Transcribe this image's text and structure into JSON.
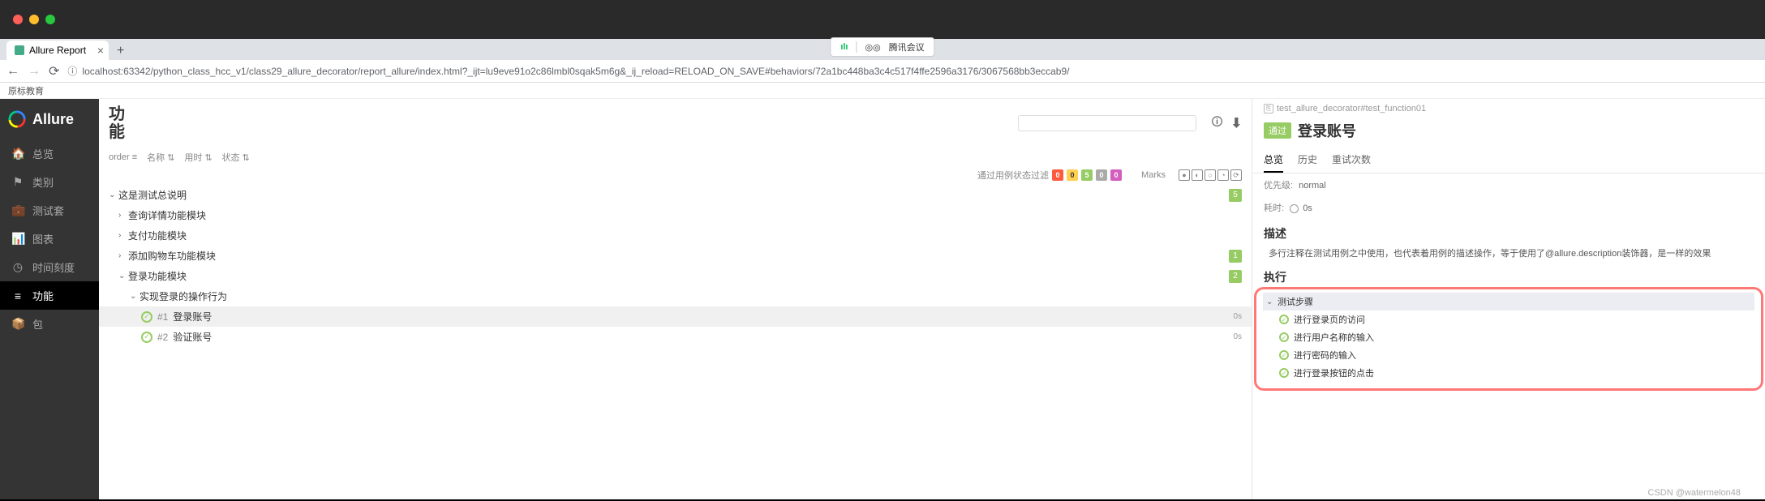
{
  "browser": {
    "tab_title": "Allure Report",
    "url": "localhost:63342/python_class_hcc_v1/class29_allure_decorator/report_allure/index.html?_ijt=lu9eve91o2c86lmbl0sqak5m6g&_ij_reload=RELOAD_ON_SAVE#behaviors/72a1bc448ba3c4c517f4ffe2596a3176/3067568bb3eccab9/",
    "bookmark": "原标教育",
    "meeting_label": "腾讯会议"
  },
  "sidebar": {
    "brand": "Allure",
    "items": [
      {
        "icon": "🏠",
        "label": "总览"
      },
      {
        "icon": "⚑",
        "label": "类别"
      },
      {
        "icon": "💼",
        "label": "测试套"
      },
      {
        "icon": "📊",
        "label": "图表"
      },
      {
        "icon": "◷",
        "label": "时间刻度"
      },
      {
        "icon": "≡",
        "label": "功能"
      },
      {
        "icon": "📦",
        "label": "包"
      }
    ]
  },
  "center": {
    "title": "功能",
    "sort": {
      "order_label": "order",
      "cols": [
        "名称",
        "用时",
        "状态"
      ]
    },
    "filter_label": "通过用例状态过滤",
    "status_counts": [
      "0",
      "0",
      "5",
      "0",
      "0"
    ],
    "marks_label": "Marks",
    "tree": {
      "root": {
        "label": "这是测试总说明",
        "count": "5"
      },
      "modules": [
        {
          "label": "查询详情功能模块"
        },
        {
          "label": "支付功能模块"
        },
        {
          "label": "添加购物车功能模块"
        }
      ],
      "login_module": {
        "label": "登录功能模块",
        "count": "2"
      },
      "login_story": {
        "label": "实现登录的操作行为"
      },
      "tests": [
        {
          "num": "#1",
          "label": "登录账号",
          "dur": "0s"
        },
        {
          "num": "#2",
          "label": "验证账号",
          "dur": "0s"
        }
      ]
    }
  },
  "detail": {
    "breadcrumb": "test_allure_decorator#test_function01",
    "status": "通过",
    "title": "登录账号",
    "tabs": [
      "总览",
      "历史",
      "重试次数"
    ],
    "priority_label": "优先级:",
    "priority_value": "normal",
    "duration_label": "耗时:",
    "duration_value": "0s",
    "desc_title": "描述",
    "desc_text": "多行注释在测试用例之中使用，也代表着用例的描述操作，等于使用了@allure.description装饰器，是一样的效果",
    "exec_title": "执行",
    "steps_title": "测试步骤",
    "steps": [
      "进行登录页的访问",
      "进行用户名称的输入",
      "进行密码的输入",
      "进行登录按钮的点击"
    ]
  },
  "watermark": "CSDN @watermelon48"
}
